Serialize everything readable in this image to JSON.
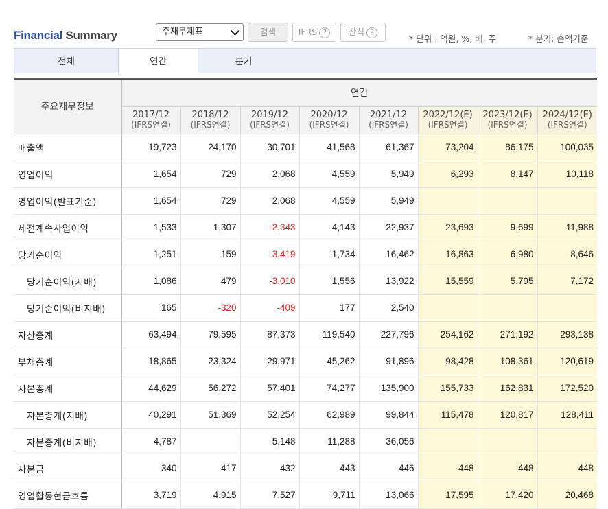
{
  "header": {
    "title_part1": "Financial",
    "title_part2": " Summary",
    "select_value": "주재무제표",
    "search_label": "검색",
    "ifrs_label": "IFRS",
    "calc_label": "산식",
    "help_glyph": "?",
    "unit_note": "* 단위 : 억원, %, 배, 주",
    "quarter_note": "* 분기: 순액기준"
  },
  "tabs": [
    "전체",
    "연간",
    "분기"
  ],
  "table": {
    "label_header": "주요재무정보",
    "period_header": "연간",
    "columns": [
      {
        "period": "2017/12",
        "basis": "(IFRS연결)",
        "estimate": false
      },
      {
        "period": "2018/12",
        "basis": "(IFRS연결)",
        "estimate": false
      },
      {
        "period": "2019/12",
        "basis": "(IFRS연결)",
        "estimate": false
      },
      {
        "period": "2020/12",
        "basis": "(IFRS연결)",
        "estimate": false
      },
      {
        "period": "2021/12",
        "basis": "(IFRS연결)",
        "estimate": false
      },
      {
        "period": "2022/12(E)",
        "basis": "(IFRS연결)",
        "estimate": true
      },
      {
        "period": "2023/12(E)",
        "basis": "(IFRS연결)",
        "estimate": true
      },
      {
        "period": "2024/12(E)",
        "basis": "(IFRS연결)",
        "estimate": true
      }
    ],
    "rows": [
      {
        "label": "매출액",
        "indent": false,
        "sep": false,
        "values": [
          "19,723",
          "24,170",
          "30,701",
          "41,568",
          "61,367",
          "73,204",
          "86,175",
          "100,035"
        ]
      },
      {
        "label": "영업이익",
        "indent": false,
        "sep": false,
        "values": [
          "1,654",
          "729",
          "2,068",
          "4,559",
          "5,949",
          "6,293",
          "8,147",
          "10,118"
        ]
      },
      {
        "label": "영업이익(발표기준)",
        "indent": false,
        "sep": false,
        "values": [
          "1,654",
          "729",
          "2,068",
          "4,559",
          "5,949",
          "",
          "",
          ""
        ]
      },
      {
        "label": "세전계속사업이익",
        "indent": false,
        "sep": true,
        "values": [
          "1,533",
          "1,307",
          "-2,343",
          "4,143",
          "22,937",
          "23,693",
          "9,699",
          "11,988"
        ]
      },
      {
        "label": "당기순이익",
        "indent": false,
        "sep": false,
        "values": [
          "1,251",
          "159",
          "-3,419",
          "1,734",
          "16,462",
          "16,863",
          "6,980",
          "8,646"
        ]
      },
      {
        "label": "당기순이익(지배)",
        "indent": true,
        "sep": false,
        "values": [
          "1,086",
          "479",
          "-3,010",
          "1,556",
          "13,922",
          "15,559",
          "5,795",
          "7,172"
        ]
      },
      {
        "label": "당기순이익(비지배)",
        "indent": true,
        "sep": false,
        "values": [
          "165",
          "-320",
          "-409",
          "177",
          "2,540",
          "",
          "",
          ""
        ]
      },
      {
        "label": "자산총계",
        "indent": false,
        "sep": true,
        "values": [
          "63,494",
          "79,595",
          "87,373",
          "119,540",
          "227,796",
          "254,162",
          "271,192",
          "293,138"
        ]
      },
      {
        "label": "부채총계",
        "indent": false,
        "sep": false,
        "values": [
          "18,865",
          "23,324",
          "29,971",
          "45,262",
          "91,896",
          "98,428",
          "108,361",
          "120,619"
        ]
      },
      {
        "label": "자본총계",
        "indent": false,
        "sep": false,
        "values": [
          "44,629",
          "56,272",
          "57,401",
          "74,277",
          "135,900",
          "155,733",
          "162,831",
          "172,520"
        ]
      },
      {
        "label": "자본총계(지배)",
        "indent": true,
        "sep": false,
        "values": [
          "40,291",
          "51,369",
          "52,254",
          "62,989",
          "99,844",
          "115,478",
          "120,817",
          "128,411"
        ]
      },
      {
        "label": "자본총계(비지배)",
        "indent": true,
        "sep": true,
        "values": [
          "4,787",
          "",
          "5,148",
          "11,288",
          "36,056",
          "",
          "",
          ""
        ]
      },
      {
        "label": "자본금",
        "indent": false,
        "sep": false,
        "values": [
          "340",
          "417",
          "432",
          "443",
          "446",
          "448",
          "448",
          "448"
        ]
      },
      {
        "label": "영업활동현금흐름",
        "indent": false,
        "sep": false,
        "values": [
          "3,719",
          "4,915",
          "7,527",
          "9,711",
          "13,066",
          "17,595",
          "17,420",
          "20,468"
        ]
      }
    ]
  }
}
